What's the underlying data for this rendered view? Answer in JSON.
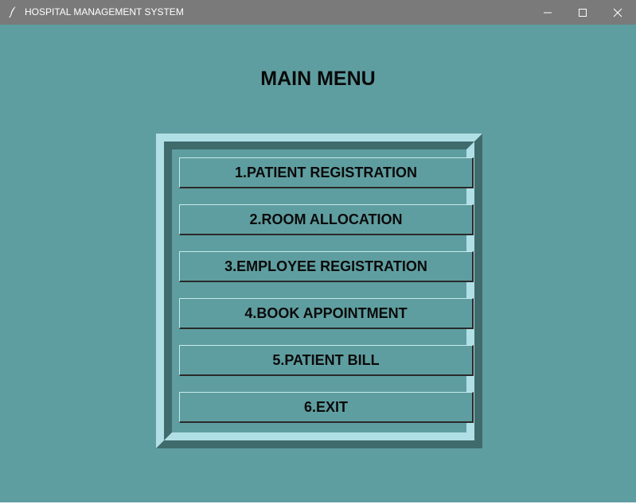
{
  "window": {
    "title": "HOSPITAL MANAGEMENT SYSTEM",
    "icons": {
      "app": "feather-icon",
      "minimize": "minimize-icon",
      "maximize": "maximize-icon",
      "close": "close-icon"
    }
  },
  "main": {
    "title": "MAIN MENU",
    "menu_items": [
      {
        "label": "1.PATIENT REGISTRATION"
      },
      {
        "label": "2.ROOM ALLOCATION"
      },
      {
        "label": "3.EMPLOYEE REGISTRATION"
      },
      {
        "label": "4.BOOK APPOINTMENT"
      },
      {
        "label": "5.PATIENT BILL"
      },
      {
        "label": "6.EXIT"
      }
    ]
  },
  "colors": {
    "background": "#5f9ea0",
    "titlebar": "#7a7a7a",
    "frame_light": "#b0e0e6",
    "frame_dark": "#3f6b6d",
    "text": "#0a0a0a"
  }
}
